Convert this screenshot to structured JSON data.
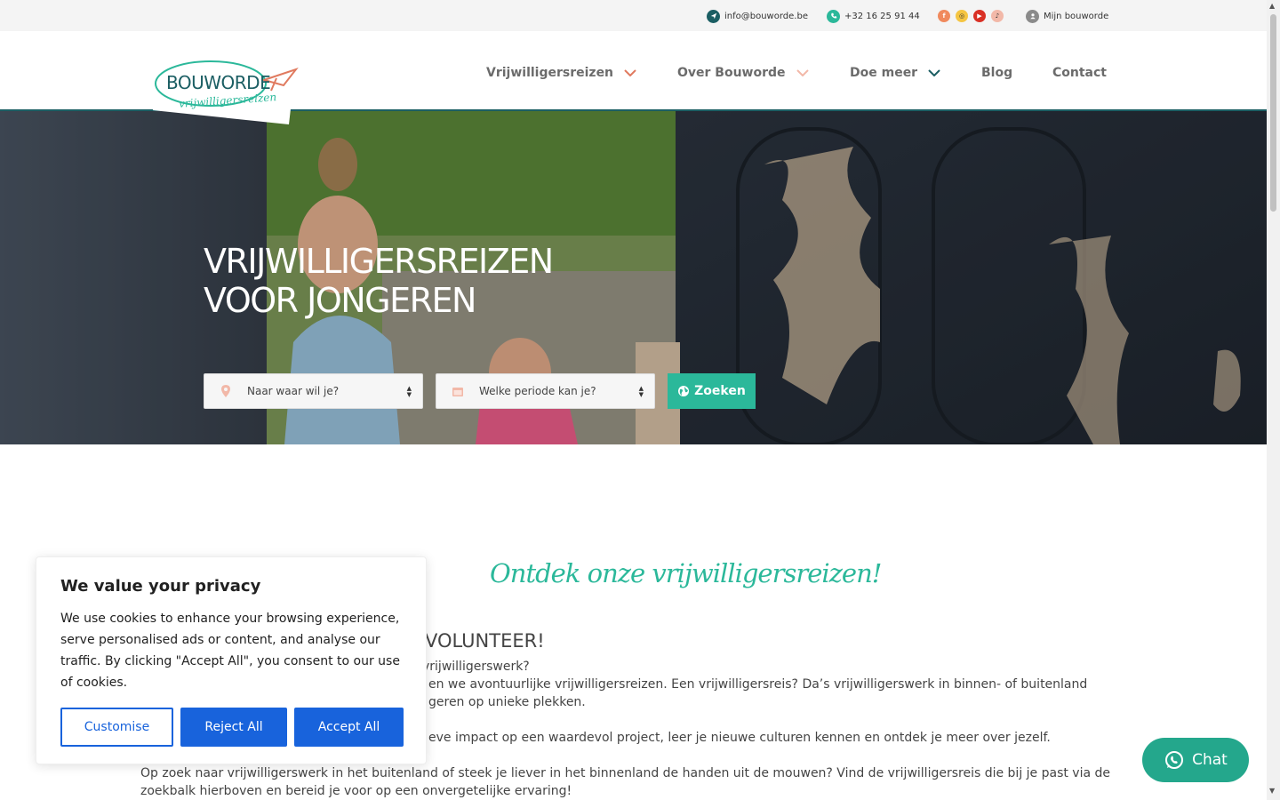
{
  "topbar": {
    "email": "info@bouworde.be",
    "phone": "+32 16 25 91 44",
    "account": "Mijn bouworde"
  },
  "social": [
    "facebook-icon",
    "instagram-icon",
    "youtube-icon",
    "tiktok-icon"
  ],
  "logo": {
    "main": "BOUWORDE",
    "tagline": "vrijwilligersreizen"
  },
  "nav": [
    {
      "label": "Vrijwilligersreizen",
      "chevron": "#e07a5f"
    },
    {
      "label": "Over Bouworde",
      "chevron": "#f2b8a8"
    },
    {
      "label": "Doe meer",
      "chevron": "#1b5e63"
    },
    {
      "label": "Blog"
    },
    {
      "label": "Contact"
    }
  ],
  "hero": {
    "title_line1": "VRIJWILLIGERSREIZEN",
    "title_line2": "VOOR JONGEREN",
    "destination_placeholder": "Naar waar wil je?",
    "period_placeholder": "Welke periode kan je?",
    "search_label": "Zoeken"
  },
  "content": {
    "script_title": "Ontdek onze vrijwilligersreizen!",
    "subtitle": "VOLUNTEER!",
    "p1": "vrijwilligerswerk?",
    "p2": "en we avontuurlijke vrijwilligersreizen. Een vrijwilligersreis? Da’s vrijwilligerswerk in binnen- of buitenland",
    "p3": "geren op unieke plekken.",
    "p4": "eve impact op een waardevol project, leer je nieuwe culturen kennen en ontdek je meer over jezelf.",
    "p5": "Op zoek naar vrijwilligerswerk in het buitenland of steek je liever in het binnenland de handen uit de mouwen? Vind de vrijwilligersreis die bij je past via de",
    "p6": "zoekbalk hierboven en bereid je voor op een onvergetelijke ervaring!"
  },
  "cookie": {
    "title": "We value your privacy",
    "text": "We use cookies to enhance your browsing experience, serve personalised ads or content, and analyse our traffic. By clicking \"Accept All\", you consent to our use of cookies.",
    "customise": "Customise",
    "reject": "Reject All",
    "accept": "Accept All"
  },
  "chat": {
    "label": "Chat"
  },
  "colors": {
    "teal": "#2bb89a",
    "darkteal": "#1b5e63",
    "blue": "#1863dc",
    "coral": "#e07a5f"
  }
}
